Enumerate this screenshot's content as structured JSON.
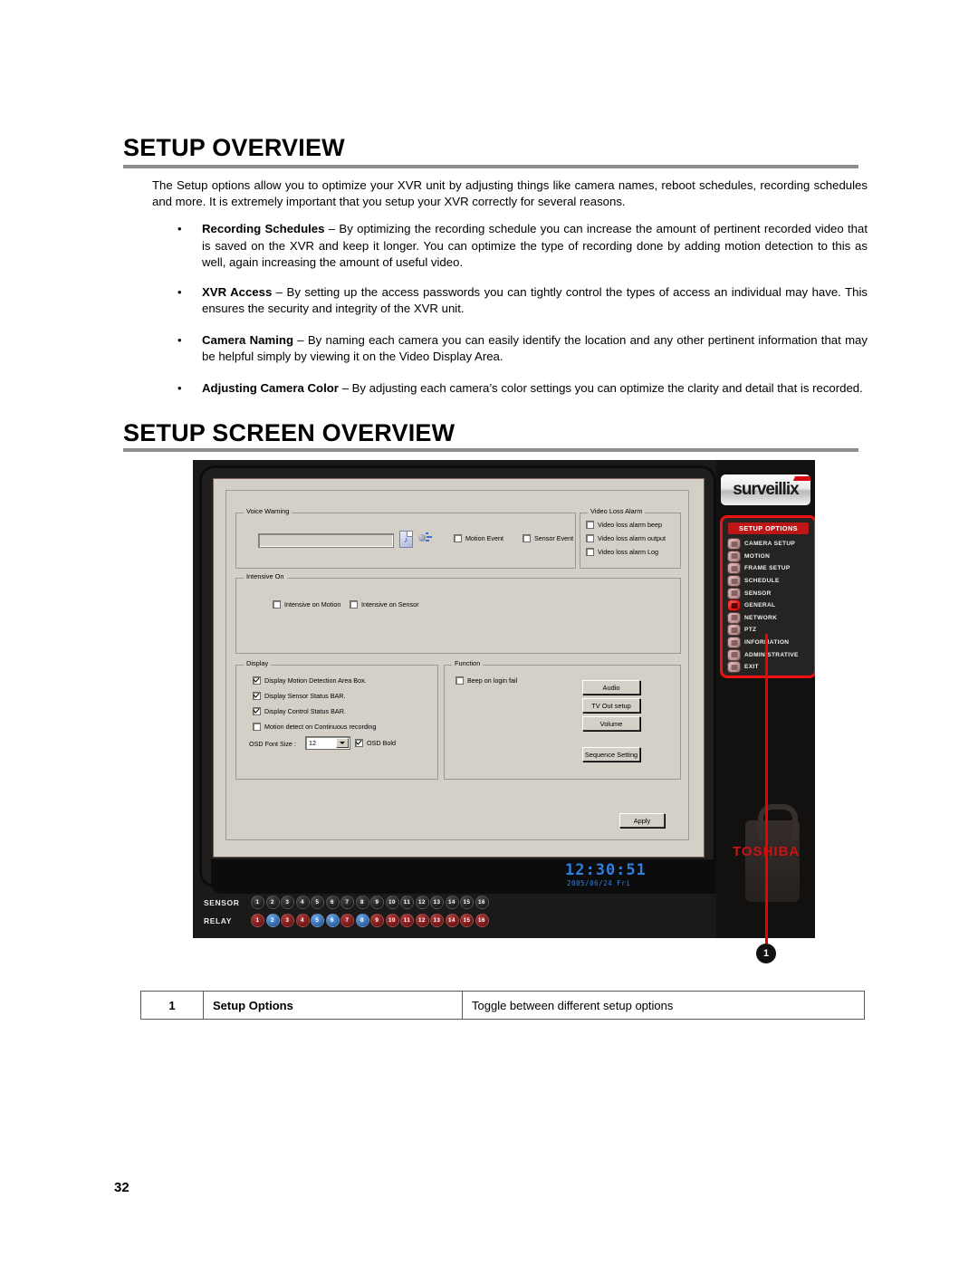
{
  "page": {
    "number": "32"
  },
  "section1": {
    "heading": "SETUP OVERVIEW",
    "intro": "The Setup options allow you to optimize your XVR unit by adjusting things like camera names, reboot schedules, recording schedules and more. It is extremely important that you setup your XVR correctly for several reasons.",
    "bullets": [
      {
        "term": "Recording Schedules",
        "dash": " – ",
        "text": "By optimizing the recording schedule you can increase the amount of pertinent recorded video that is saved on the XVR and keep it longer. You can optimize the type of recording done by adding motion detection to this as well, again increasing the amount of useful video."
      },
      {
        "term": "XVR Access",
        "dash": " – ",
        "text": "By setting up the access passwords you can tightly control the types of access an individual may have. This ensures the security and integrity of the XVR unit."
      },
      {
        "term": "Camera Naming",
        "dash": " – ",
        "text": "By naming each camera you can easily identify the location and any other pertinent information that may be helpful simply by viewing it on the Video Display Area."
      },
      {
        "term": "Adjusting Camera Color",
        "dash": " – ",
        "text": "By adjusting each camera’s color settings you can optimize the clarity and detail that is recorded."
      }
    ]
  },
  "section2": {
    "heading": "SETUP SCREEN OVERVIEW"
  },
  "screenshot": {
    "brand_logo": "surveillix",
    "vendor_logo": "TOSHIBA",
    "voice_warning": {
      "legend": "Voice Warning",
      "field_value": "",
      "icons": [
        "audio-file-icon",
        "speaker-icon"
      ],
      "checkboxes": [
        {
          "label": "Motion Event",
          "checked": false
        },
        {
          "label": "Sensor Event",
          "checked": false
        }
      ]
    },
    "video_loss_alarm": {
      "legend": "Video Loss Alarm",
      "checkboxes": [
        {
          "label": "Video loss alarm beep",
          "checked": false
        },
        {
          "label": "Video loss alarm output",
          "checked": false
        },
        {
          "label": "Video loss alarm Log",
          "checked": false
        }
      ]
    },
    "intensive_on": {
      "legend": "Intensive On",
      "checkboxes": [
        {
          "label": "Intensive on Motion",
          "checked": false
        },
        {
          "label": "Intensive on Sensor",
          "checked": false
        }
      ]
    },
    "display": {
      "legend": "Display",
      "checkboxes": [
        {
          "label": "Display Motion Detection Area Box.",
          "checked": true
        },
        {
          "label": "Display Sensor Status BAR.",
          "checked": true
        },
        {
          "label": "Display Control Status BAR.",
          "checked": true
        },
        {
          "label": "Motion detect on Continuous recording",
          "checked": false
        }
      ],
      "osd_font_size_label": "OSD Font Size :",
      "osd_font_size_value": "12",
      "osd_bold": {
        "label": "OSD Bold",
        "checked": true
      }
    },
    "function": {
      "legend": "Function",
      "checkboxes": [
        {
          "label": "Beep on login fail",
          "checked": false
        }
      ],
      "buttons": [
        "Audio",
        "TV Out setup",
        "Volume",
        "Sequence Setting"
      ]
    },
    "apply_button": "Apply",
    "clock": {
      "time": "12:30:51",
      "date": "2005/06/24 Fri"
    },
    "setup_options": {
      "title": "SETUP OPTIONS",
      "active": "GENERAL",
      "items": [
        {
          "label": "CAMERA SETUP",
          "icon": "camera-icon"
        },
        {
          "label": "MOTION",
          "icon": "running-person-icon"
        },
        {
          "label": "FRAME SETUP",
          "icon": "frame-icon"
        },
        {
          "label": "SCHEDULE",
          "icon": "calendar-icon"
        },
        {
          "label": "SENSOR",
          "icon": "sensor-icon"
        },
        {
          "label": "GENERAL",
          "icon": "gear-icon"
        },
        {
          "label": "NETWORK",
          "icon": "network-icon"
        },
        {
          "label": "PTZ",
          "icon": "dome-camera-icon"
        },
        {
          "label": "INFORMATION",
          "icon": "info-icon"
        },
        {
          "label": "ADMINISTRATIVE",
          "icon": "user-icon"
        },
        {
          "label": "EXIT",
          "icon": "door-icon"
        }
      ]
    },
    "sensor_row": {
      "label": "SENSOR",
      "leds": [
        "1",
        "2",
        "3",
        "4",
        "5",
        "6",
        "7",
        "8",
        "9",
        "10",
        "11",
        "12",
        "13",
        "14",
        "15",
        "16"
      ],
      "color": "#161616"
    },
    "relay_row": {
      "label": "RELAY",
      "leds": [
        "1",
        "2",
        "3",
        "4",
        "5",
        "6",
        "7",
        "8",
        "9",
        "10",
        "11",
        "12",
        "13",
        "14",
        "15",
        "16"
      ],
      "blue_indices": [
        2,
        5,
        6,
        8
      ],
      "color": "#6e1212",
      "blue_color": "#2a5e9e"
    }
  },
  "callout": {
    "marker": "1"
  },
  "legend_table": {
    "rows": [
      {
        "num": "1",
        "key": "Setup Options",
        "desc": "Toggle between different setup options"
      }
    ]
  }
}
